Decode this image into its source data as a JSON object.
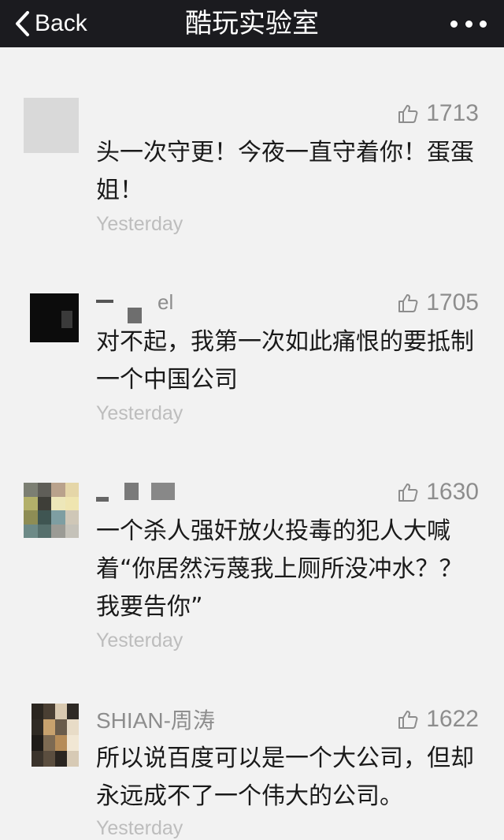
{
  "nav": {
    "back_label": "Back",
    "title": "酷玩实验室",
    "more_icon": "more-dots-icon"
  },
  "comments": [
    {
      "nickname": "",
      "likes": "1713",
      "text": "头一次守更！今夜一直守着你！蛋蛋姐！",
      "time": "Yesterday"
    },
    {
      "nickname": "el",
      "likes": "1705",
      "text": "对不起，我第一次如此痛恨的要抵制一个中国公司",
      "time": "Yesterday"
    },
    {
      "nickname": "",
      "likes": "1630",
      "text": "一个杀人强奸放火投毒的犯人大喊着“你居然污蔑我上厕所没冲水？？我要告你”",
      "time": "Yesterday"
    },
    {
      "nickname": "SHIAN-周涛",
      "likes": "1622",
      "text": "所以说百度可以是一个大公司，但却永远成不了一个伟大的公司。",
      "time": "Yesterday"
    }
  ],
  "colors": {
    "nav_bg": "#1b1b1f",
    "page_bg": "#f2f2f2",
    "meta_text": "#8d8d8d",
    "time_text": "#bdbdbd"
  }
}
